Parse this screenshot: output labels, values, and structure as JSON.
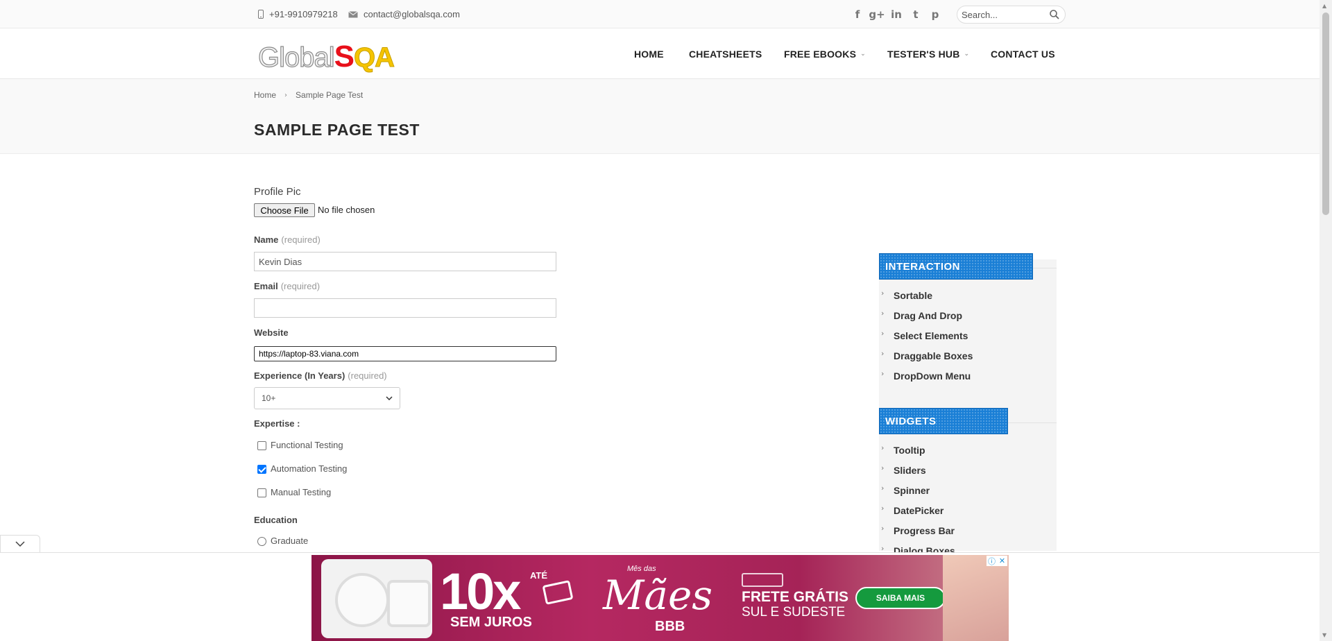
{
  "topbar": {
    "phone": "+91-9910979218",
    "email": "contact@globalsqa.com",
    "social": [
      "f",
      "g+",
      "in",
      "t",
      "p"
    ],
    "search_placeholder": "Search..."
  },
  "header": {
    "logo_part1": "Global",
    "logo_part2": "S",
    "logo_part3": "QA",
    "nav": [
      "HOME",
      "CHEATSHEETS",
      "FREE EBOOKS",
      "TESTER'S HUB",
      "CONTACT US"
    ]
  },
  "breadcrumb": {
    "home": "Home",
    "current": "Sample Page Test"
  },
  "page_title": "SAMPLE PAGE TEST",
  "form": {
    "profile_pic_label": "Profile Pic",
    "choose_file": "Choose File",
    "no_file": "No file chosen",
    "name_label": "Name",
    "required": "(required)",
    "name_value": "Kevin Dias",
    "email_label": "Email",
    "email_value": "",
    "website_label": "Website",
    "website_value": "https://laptop-83.viana.com",
    "experience_label": "Experience (In Years)",
    "experience_value": "10+",
    "expertise_label": "Expertise :",
    "expertise_options": [
      {
        "label": "Functional Testing",
        "checked": false
      },
      {
        "label": "Automation Testing",
        "checked": true
      },
      {
        "label": "Manual Testing",
        "checked": false
      }
    ],
    "education_label": "Education",
    "education_options": [
      "Graduate"
    ]
  },
  "sidebar": {
    "interaction_title": "INTERACTION",
    "interaction_items": [
      "Sortable",
      "Drag And Drop",
      "Select Elements",
      "Draggable Boxes",
      "DropDown Menu"
    ],
    "widgets_title": "WIDGETS",
    "widgets_items": [
      "Tooltip",
      "Sliders",
      "Spinner",
      "DatePicker",
      "Progress Bar",
      "Dialog Boxes"
    ]
  },
  "ad": {
    "ate": "ATÉ",
    "big": "10x",
    "juros": "SEM JUROS",
    "mes": "Mês das",
    "maes": "Mães",
    "bbb": "BBB",
    "frete": "FRETE GRÁTIS",
    "sul": "SUL E SUDESTE",
    "saiba": "SAIBA MAIS",
    "colors": {
      "primary": "#b52861",
      "button": "#159a3e"
    }
  }
}
